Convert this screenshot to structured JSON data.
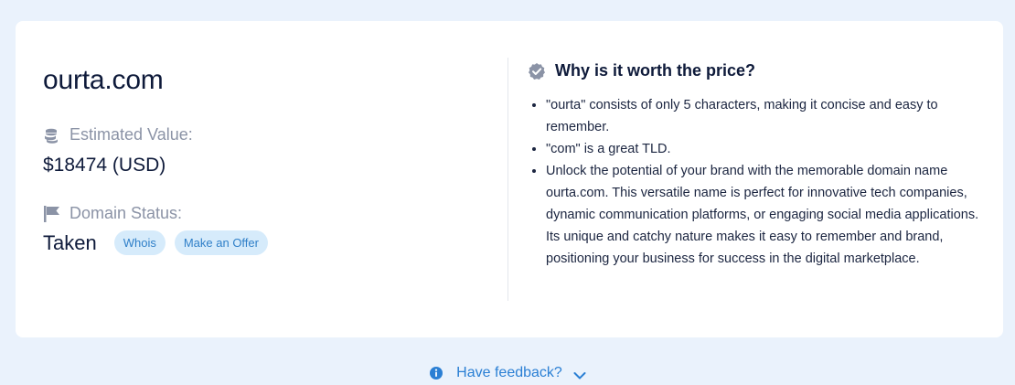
{
  "domain": {
    "name": "ourta.com"
  },
  "estimated_value": {
    "label": "Estimated Value:",
    "value": "$18474 (USD)",
    "icon": "coins-icon"
  },
  "domain_status": {
    "label": "Domain Status:",
    "value": "Taken",
    "icon": "flag-icon",
    "whois_label": "Whois",
    "offer_label": "Make an Offer"
  },
  "why": {
    "title": "Why is it worth the price?",
    "icon": "verified-badge-icon",
    "reasons": [
      "\"ourta\" consists of only 5 characters, making it concise and easy to remember.",
      "\"com\" is a great TLD.",
      "Unlock the potential of your brand with the memorable domain name ourta.com. This versatile name is perfect for innovative tech companies, dynamic communication platforms, or engaging social media applications. Its unique and catchy nature makes it easy to remember and brand, positioning your business for success in the digital marketplace."
    ]
  },
  "feedback": {
    "label": "Have feedback?",
    "icon": "info-icon"
  },
  "colors": {
    "background": "#eaf2fc",
    "card": "#ffffff",
    "accent": "#2a7fd4",
    "pill_bg": "#d6ebfb",
    "muted": "#8b93a6",
    "text": "#0e1a3a"
  }
}
